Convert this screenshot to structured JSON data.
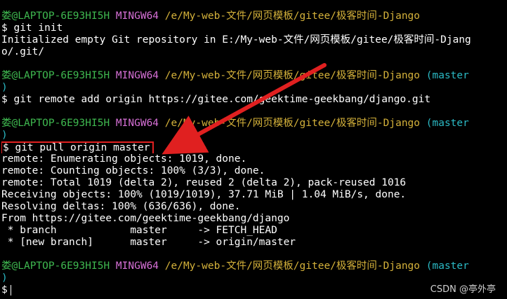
{
  "prompt": {
    "user_host": "娄@LAPTOP-6E93HI5H",
    "shell": "MINGW64",
    "path": "/e/My-web-文件/网页模板/gitee/极客时间-Django",
    "branch_open": "(master",
    "branch_close": ")",
    "symbol": "$"
  },
  "blocks": [
    {
      "command": "git init",
      "output": [
        "Initialized empty Git repository in E:/My-web-文件/网页模板/gitee/极客时间-Djang",
        "o/.git/"
      ]
    },
    {
      "command": "git remote add origin https://gitee.com/geektime-geekbang/django.git",
      "output": []
    },
    {
      "command": "git pull origin master",
      "output": [
        "remote: Enumerating objects: 1019, done.",
        "remote: Counting objects: 100% (3/3), done.",
        "remote: Total 1019 (delta 2), reused 2 (delta 2), pack-reused 1016",
        "Receiving objects: 100% (1019/1019), 37.71 MiB | 1.04 MiB/s, done.",
        "Resolving deltas: 100% (636/636), done.",
        "From https://gitee.com/geektime-geekbang/django",
        " * branch            master     -> FETCH_HEAD",
        " * [new branch]      master     -> origin/master"
      ]
    }
  ],
  "watermark": "CSDN @亭外亭",
  "colors": {
    "user": "#3fb950",
    "shell": "#d670d6",
    "path": "#d4b13a",
    "branch": "#2bbac5",
    "annotation": "#e02020"
  }
}
